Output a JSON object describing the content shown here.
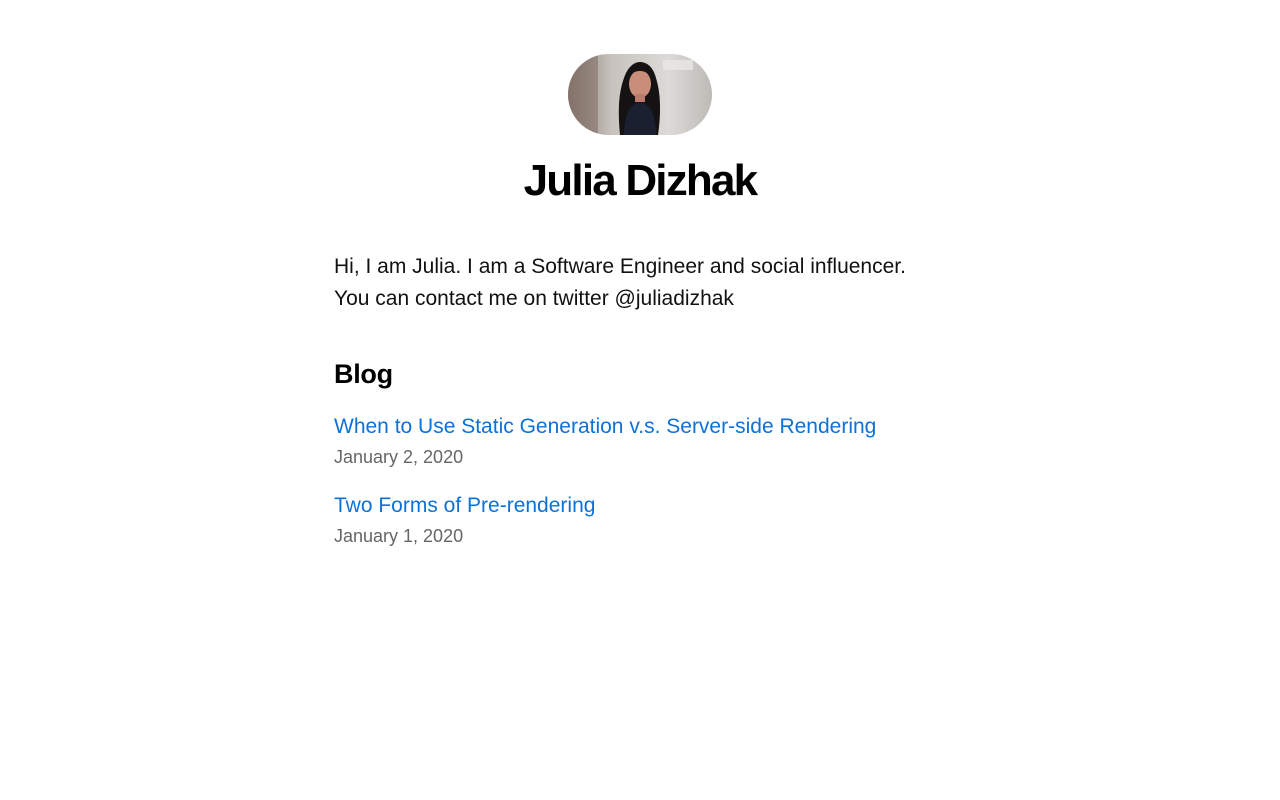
{
  "profile": {
    "name": "Julia Dizhak",
    "bio_line1": "Hi, I am Julia. I am a Software Engineer and social influencer.",
    "bio_line2": "You can contact me on twitter @juliadizhak"
  },
  "blog": {
    "heading": "Blog",
    "posts": [
      {
        "title": "When to Use Static Generation v.s. Server-side Rendering",
        "date": "January 2, 2020"
      },
      {
        "title": "Two Forms of Pre-rendering",
        "date": "January 1, 2020"
      }
    ]
  },
  "colors": {
    "link": "#0b72d9",
    "date": "#666666",
    "text": "#111111"
  }
}
